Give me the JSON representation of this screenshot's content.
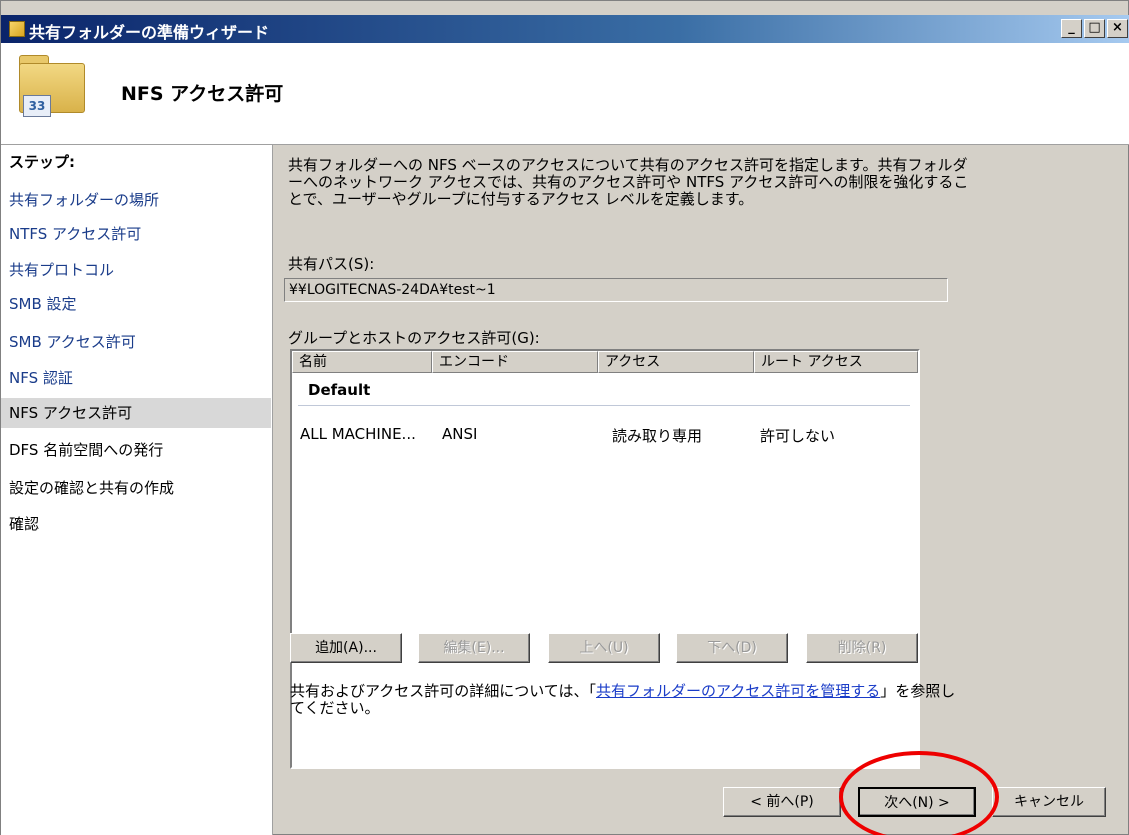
{
  "window": {
    "title": "共有フォルダーの準備ウィザード",
    "controls": {
      "minimize": "_",
      "maximize": "□",
      "close": "×"
    }
  },
  "header": {
    "title": "NFS アクセス許可",
    "icon": "shared-folder-icon",
    "badge": "33"
  },
  "steps": {
    "heading": "ステップ:",
    "items": [
      {
        "label": "共有フォルダーの場所",
        "state": "link"
      },
      {
        "label": "NTFS アクセス許可",
        "state": "link"
      },
      {
        "label": "共有プロトコル",
        "state": "link"
      },
      {
        "label": "SMB 設定",
        "state": "link"
      },
      {
        "label": "SMB アクセス許可",
        "state": "link"
      },
      {
        "label": "NFS 認証",
        "state": "link"
      },
      {
        "label": "NFS アクセス許可",
        "state": "current"
      },
      {
        "label": "DFS 名前空間への発行",
        "state": "plain"
      },
      {
        "label": "設定の確認と共有の作成",
        "state": "plain"
      },
      {
        "label": "確認",
        "state": "plain"
      }
    ]
  },
  "content": {
    "description": "共有フォルダーへの NFS ベースのアクセスについて共有のアクセス許可を指定します。共有フォルダーへのネットワーク アクセスでは、共有のアクセス許可や NTFS アクセス許可への制限を強化することで、ユーザーやグループに付与するアクセス レベルを定義します。",
    "share_path_label": "共有パス(S):",
    "share_path_value": "¥¥LOGITECNAS-24DA¥test~1",
    "groups_label": "グループとホストのアクセス許可(G):",
    "columns": [
      "名前",
      "エンコード",
      "アクセス",
      "ルート アクセス"
    ],
    "group_name": "Default",
    "rows": [
      {
        "name": "ALL MACHINE...",
        "encoding": "ANSI",
        "access": "読み取り専用",
        "root_access": "許可しない"
      }
    ],
    "buttons": {
      "add": "追加(A)...",
      "edit": "編集(E)...",
      "up": "上へ(U)",
      "down": "下へ(D)",
      "remove": "削除(R)"
    },
    "info_prefix": "共有およびアクセス許可の詳細については、「",
    "info_link": "共有フォルダーのアクセス許可を管理する",
    "info_suffix": "」を参照してください。"
  },
  "footer": {
    "back": "< 前へ(P)",
    "next": "次へ(N) >",
    "cancel": "キャンセル"
  },
  "colors": {
    "titlebar_start": "#0a246a",
    "link": "#1a3cc8",
    "highlight_ring": "#e00000"
  }
}
